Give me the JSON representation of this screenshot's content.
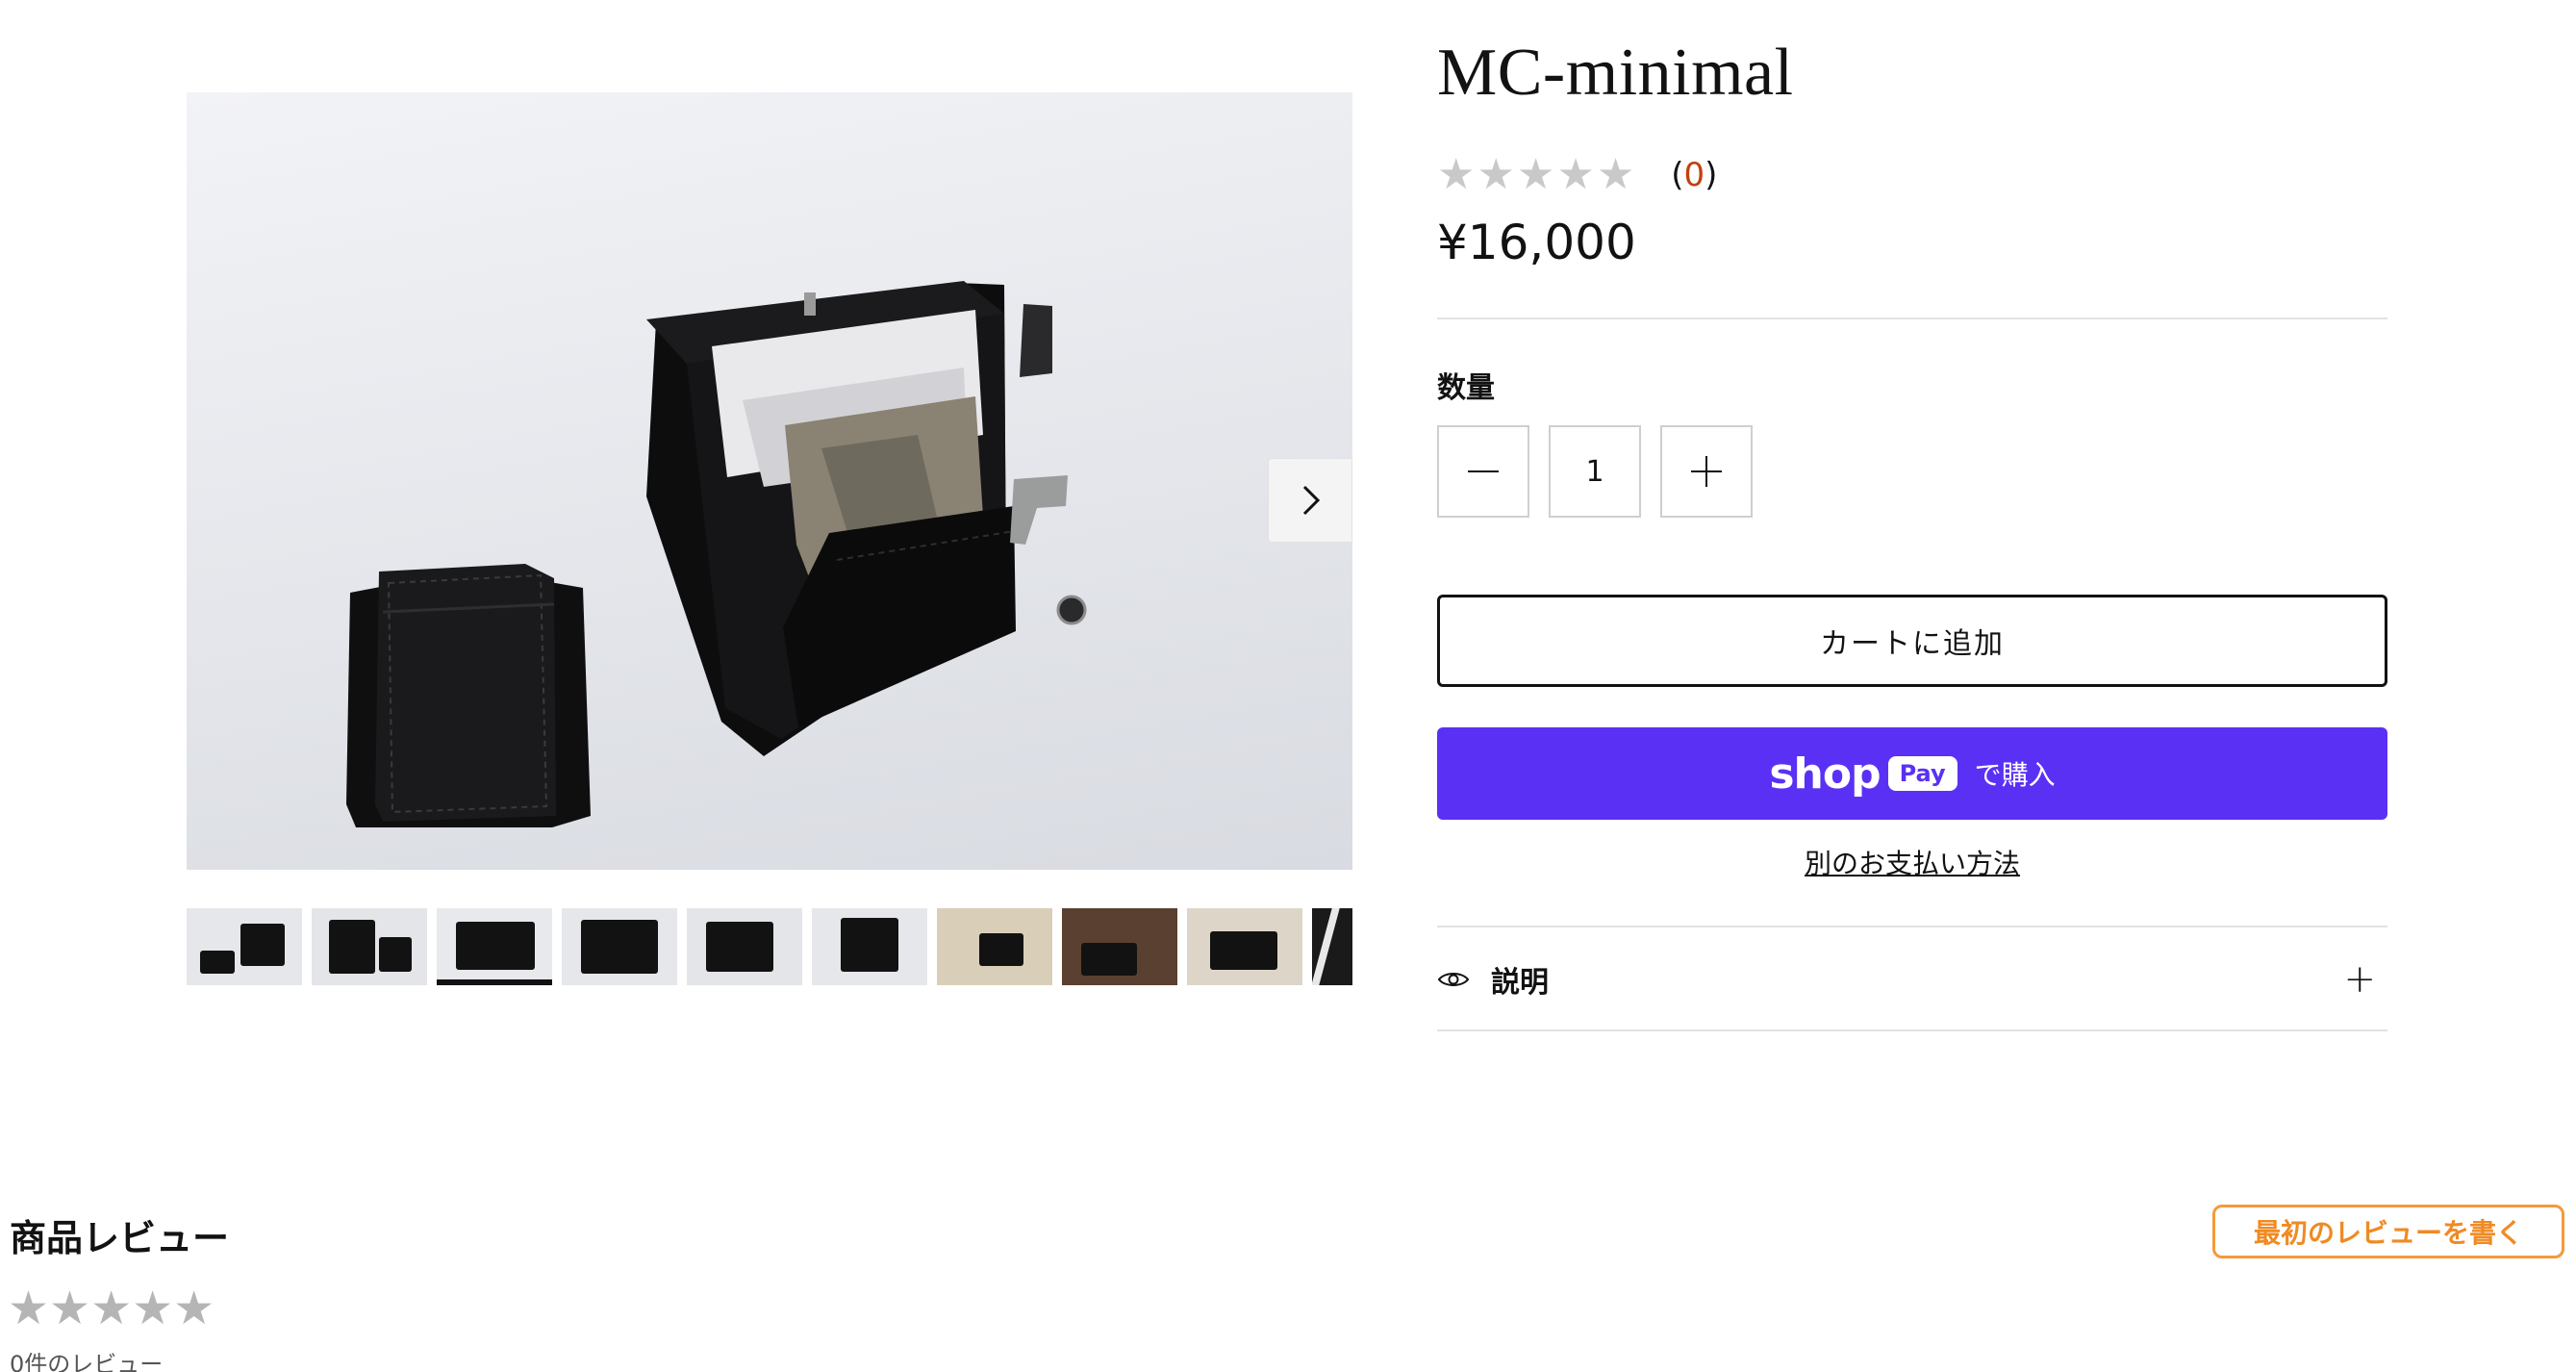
{
  "product": {
    "title": "MC-minimal",
    "rating_count_open": "(",
    "rating_count": "0",
    "rating_count_close": ")",
    "price": "¥16,000"
  },
  "quantity": {
    "label": "数量",
    "value": "1",
    "decrement_icon": "minus-icon",
    "increment_icon": "plus-icon"
  },
  "buttons": {
    "add_to_cart": "カートに追加",
    "shop_pay_brand": "shop",
    "shop_pay_badge": "Pay",
    "shop_pay_action": "で購入",
    "more_payment": "別のお支払い方法"
  },
  "accordion": {
    "icon": "eye-icon",
    "label": "説明",
    "toggle": "+"
  },
  "reviews": {
    "title": "商品レビュー",
    "write_button": "最初のレビューを書く",
    "count_text": "0件のレビュー"
  },
  "colors": {
    "shop_pay": "#5a31f4",
    "review_accent": "#f08a24"
  }
}
